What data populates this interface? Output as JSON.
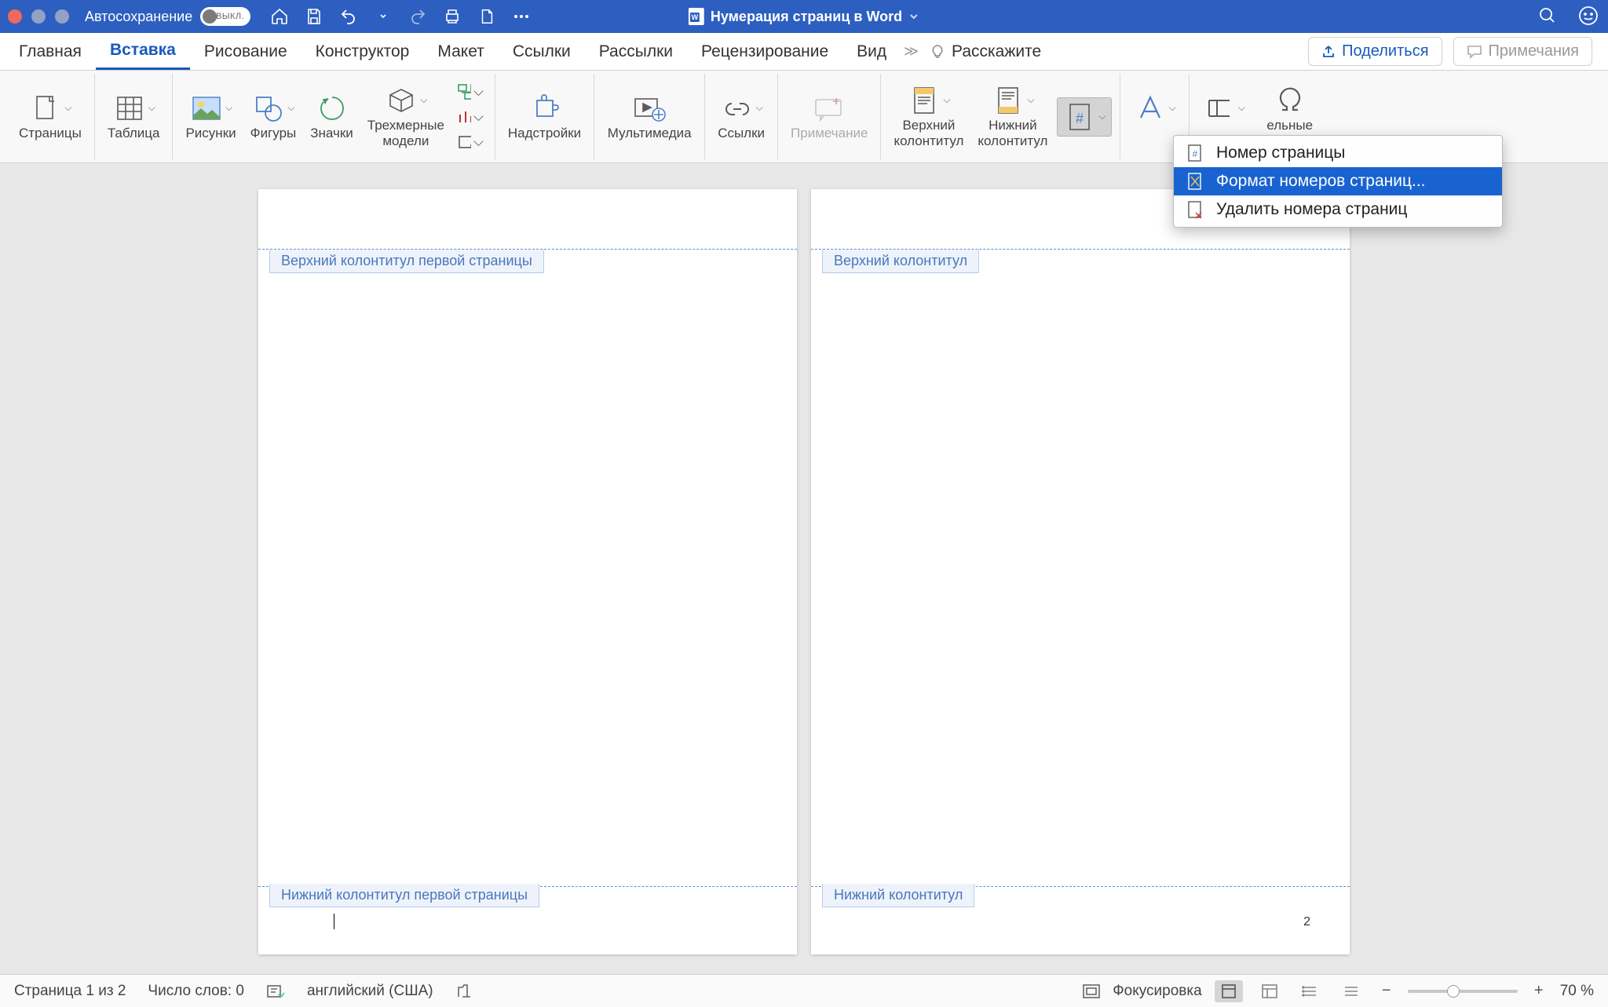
{
  "titlebar": {
    "autosave_label": "Автосохранение",
    "autosave_state": "ВЫКЛ.",
    "doc_title": "Нумерация страниц в Word"
  },
  "tabs": {
    "home": "Главная",
    "insert": "Вставка",
    "draw": "Рисование",
    "design": "Конструктор",
    "layout": "Макет",
    "references": "Ссылки",
    "mailings": "Рассылки",
    "review": "Рецензирование",
    "view": "Вид",
    "tell_me": "Расскажите",
    "share": "Поделиться",
    "comments": "Примечания"
  },
  "ribbon": {
    "pages": "Страницы",
    "table": "Таблица",
    "pictures": "Рисунки",
    "shapes": "Фигуры",
    "icons": "Значки",
    "models3d": "Трехмерные\nмодели",
    "addins": "Надстройки",
    "media": "Мультимедиа",
    "links": "Ссылки",
    "comment": "Примечание",
    "header": "Верхний\nколонтитул",
    "footer": "Нижний\nколонтитул",
    "page_number": "Номер\nстраницы",
    "text_tail": "ельные\nлы"
  },
  "dropdown": {
    "item1": "Номер страницы",
    "item2": "Формат номеров страниц...",
    "item3": "Удалить номера страниц"
  },
  "doc": {
    "p1_header_tag": "Верхний колонтитул первой страницы",
    "p1_footer_tag": "Нижний колонтитул первой страницы",
    "p2_header_tag": "Верхний колонтитул",
    "p2_footer_tag": "Нижний колонтитул",
    "p2_number": "2"
  },
  "status": {
    "page": "Страница 1 из 2",
    "words": "Число слов: 0",
    "lang": "английский (США)",
    "focus": "Фокусировка",
    "zoom": "70 %"
  }
}
